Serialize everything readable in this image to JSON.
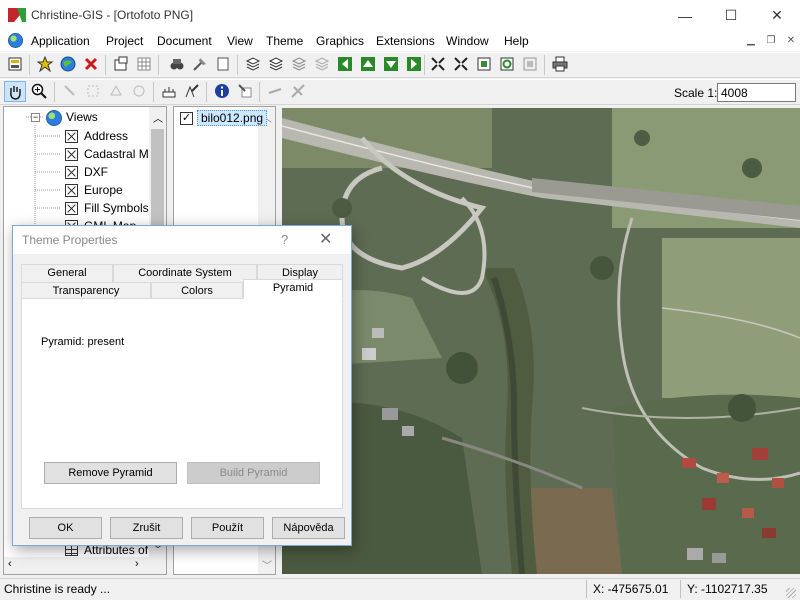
{
  "window": {
    "title": "Christine-GIS - [Ortofoto PNG]",
    "controls": [
      "—",
      "☐",
      "✕"
    ]
  },
  "menu": [
    "Application",
    "Project",
    "Document",
    "View",
    "Theme",
    "Graphics",
    "Extensions",
    "Window",
    "Help"
  ],
  "scale": {
    "label": "Scale 1:",
    "value": "4008"
  },
  "tree": {
    "root": "Views",
    "items": [
      "Address",
      "Cadastral M",
      "DXF",
      "Europe",
      "Fill Symbols",
      "GML Map"
    ],
    "bottom_item": "Attributes of"
  },
  "layers": [
    {
      "label": "bilo012.png",
      "checked": "✓"
    }
  ],
  "dialog": {
    "title": "Theme Properties",
    "help": "?",
    "close": "✕",
    "tabs_row1": [
      "General",
      "Coordinate System",
      "Display"
    ],
    "tabs_row2": [
      "Transparency",
      "Colors",
      "Pyramid"
    ],
    "active_tab": "Pyramid",
    "status_text": "Pyramid: present",
    "remove_button": "Remove Pyramid",
    "build_button": "Build Pyramid",
    "ok_button": "OK",
    "cancel_button": "Zrušit",
    "apply_button": "Použít",
    "help_button": "Nápověda"
  },
  "status": {
    "message": "Christine is ready ...",
    "x": "X: -475675.01",
    "y": "Y: -1102717.35"
  },
  "colors": {
    "accent_selection": "#cce8ff",
    "dialog_border": "#7aa7d8",
    "map_base": "#5d6b52"
  }
}
